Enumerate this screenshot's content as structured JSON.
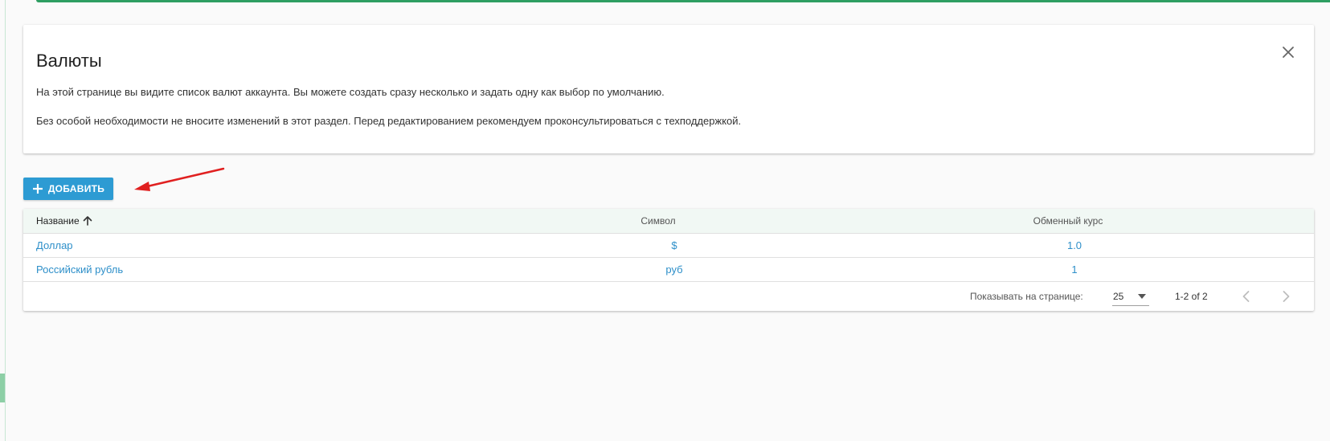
{
  "info_card": {
    "title": "Валюты",
    "paragraph_1": "На этой странице вы видите список валют аккаунта. Вы можете создать сразу несколько и задать одну как выбор по умолчанию.",
    "paragraph_2": "Без особой необходимости не вносите изменений в этот раздел. Перед редактированием рекомендуем проконсультироваться с техподдержкой.",
    "close_icon": "close-icon"
  },
  "toolbar": {
    "add_label": "ДОБАВИТЬ",
    "add_icon": "plus-icon",
    "accent_color": "#2d9bd3"
  },
  "table": {
    "columns": {
      "name": "Название",
      "symbol": "Символ",
      "rate": "Обменный курс"
    },
    "sort_icon": "arrow-up-icon",
    "rows": [
      {
        "name": "Доллар",
        "symbol": "$",
        "rate": "1.0"
      },
      {
        "name": "Российский рубль",
        "symbol": "руб",
        "rate": "1"
      }
    ],
    "link_color": "#2d8fc9",
    "header_bg": "#f1f8f4"
  },
  "pagination": {
    "per_page_label": "Показывать на странице:",
    "per_page_value": "25",
    "range": "1-2 of 2",
    "prev_icon": "chevron-left-icon",
    "next_icon": "chevron-right-icon"
  },
  "annotation": {
    "arrow_color": "#e02020"
  }
}
